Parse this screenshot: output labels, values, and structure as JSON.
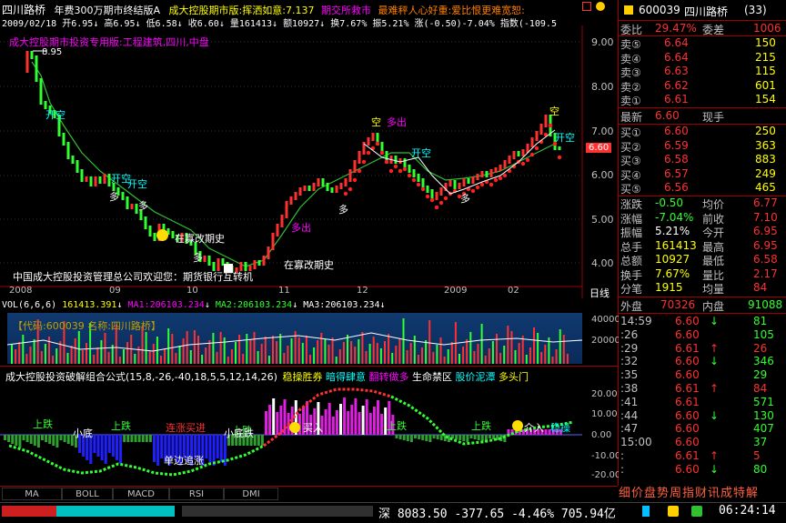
{
  "header": {
    "stock_name": "四川路桥",
    "promo1": "年费300万期市终结版A",
    "promo2": "成大控股期市版:挥洒如意:7.137",
    "promo3": "期交所救市",
    "promo4": "最难秤人心好重:爱比恨更难宽恕:",
    "ohlc_date": "2009/02/18",
    "ohlc_open": "开6.95",
    "ohlc_high": "高6.95",
    "ohlc_low": "低6.58",
    "ohlc_close": "收6.60",
    "ohlc_vol": "量161413",
    "ohlc_amt": "额10927",
    "ohlc_turn": "换7.67%",
    "ohlc_amp": "振5.21%",
    "ohlc_chg": "涨(-0.50)-7.04%",
    "ohlc_idx": "指数(-109.5",
    "subtitle": "成大控股期市投资专用版:工程建筑,四川,中盘"
  },
  "main_chart": {
    "price_ticks": [
      "9.00",
      "8.00",
      "7.00",
      "6.00",
      "5.00",
      "4.00"
    ],
    "current_price": "6.60",
    "max_label": "8.95",
    "date_labels": [
      "2008",
      "09",
      "10",
      "11",
      "12",
      "2009",
      "02"
    ],
    "period": "日线",
    "annotations": {
      "kaikong1": "开空",
      "kaikong2": "开空",
      "kaikong3": "开空",
      "kaikong4": "开空",
      "kaikong5": "开空",
      "duo1": "多",
      "duo2": "多",
      "duo3": "多",
      "duo4": "多",
      "duo5": "多",
      "duo_chu": "多出",
      "duo_chu2": "多出",
      "kong": "空",
      "kong2": "空",
      "zai_cuo_qi": "在寡改期史",
      "zai_cuo_qi2": "在寡改期史",
      "welcome": "中国成大控股投资管理总公司欢迎您：期货银行互转机"
    }
  },
  "volume_panel": {
    "title": "VOL(6,6,6)",
    "vol": "161413.391",
    "ma1": "MA1:206103.234",
    "ma2": "MA2:206103.234",
    "ma3": "MA3:206103.234",
    "code_label": "【代码:600039 名称:四川路桥】",
    "ticks": [
      "400000",
      "200000"
    ]
  },
  "indicator_panel": {
    "title": "成大控股投资破解组合公式(15,8,-26,-40,18,5,5,12,14,26)",
    "tag1": "稳操胜券",
    "tag2": "暗得肆意",
    "tag3": "翻转做多",
    "tag4": "生命禁区",
    "tag5": "股价泥潭",
    "tag6": "多头门",
    "ticks": [
      "20.00",
      "10.00",
      "0.00",
      "-10.00",
      "-20.00"
    ],
    "labels": {
      "shangdie1": "上跌",
      "xiaodi": "小底",
      "shangdie2": "上跌",
      "lianzhang": "连涨买进",
      "shangdie3": "上跌",
      "xiaodi2": "小底跌",
      "danbian": "单边追涨",
      "shangdie4": "上跌",
      "shangdie5": "上跌",
      "jinru": "买入",
      "jinru2": "介入",
      "wenyi": "稳操"
    }
  },
  "tabs": [
    "MA",
    "BOLL",
    "MACD",
    "RSI",
    "DMI"
  ],
  "right_panel": {
    "code": "600039",
    "name": "四川路桥",
    "num": "(33)",
    "weibi_label": "委比",
    "weibi_value": "29.47%",
    "weicha_label": "委差",
    "weicha_value": "1006",
    "asks": [
      {
        "label": "卖⑤",
        "price": "6.64",
        "vol": "150"
      },
      {
        "label": "卖④",
        "price": "6.64",
        "vol": "215"
      },
      {
        "label": "卖③",
        "price": "6.63",
        "vol": "115"
      },
      {
        "label": "卖②",
        "price": "6.62",
        "vol": "601"
      },
      {
        "label": "卖①",
        "price": "6.61",
        "vol": "154"
      }
    ],
    "latest_label": "最新",
    "latest_value": "6.60",
    "xianshou_label": "现手",
    "bids": [
      {
        "label": "买①",
        "price": "6.60",
        "vol": "250"
      },
      {
        "label": "买②",
        "price": "6.59",
        "vol": "363"
      },
      {
        "label": "买③",
        "price": "6.58",
        "vol": "883"
      },
      {
        "label": "买④",
        "price": "6.57",
        "vol": "249"
      },
      {
        "label": "买⑤",
        "price": "6.56",
        "vol": "465"
      }
    ],
    "stats": [
      {
        "l1": "涨跌",
        "v1": "-0.50",
        "l2": "均价",
        "v2": "6.77"
      },
      {
        "l1": "涨幅",
        "v1": "-7.04%",
        "l2": "前收",
        "v2": "7.10"
      },
      {
        "l1": "振幅",
        "v1": "5.21%",
        "l2": "今开",
        "v2": "6.95"
      },
      {
        "l1": "总手",
        "v1": "161413",
        "l2": "最高",
        "v2": "6.95"
      },
      {
        "l1": "总额",
        "v1": "10927",
        "l2": "最低",
        "v2": "6.58"
      },
      {
        "l1": "换手",
        "v1": "7.67%",
        "l2": "量比",
        "v2": "2.17"
      },
      {
        "l1": "分笔",
        "v1": "1915",
        "l2": "均量",
        "v2": "84"
      }
    ],
    "waipan_label": "外盘",
    "waipan_value": "70326",
    "neipan_label": "内盘",
    "neipan_value": "91088",
    "ticks": [
      {
        "time": "14:59",
        "price": "6.60",
        "dir": "↓",
        "vol": "81"
      },
      {
        "time": ":26",
        "price": "6.60",
        "dir": "",
        "vol": "105"
      },
      {
        "time": ":29",
        "price": "6.61",
        "dir": "↑",
        "vol": "26"
      },
      {
        "time": ":32",
        "price": "6.60",
        "dir": "↓",
        "vol": "346"
      },
      {
        "time": ":35",
        "price": "6.60",
        "dir": "",
        "vol": "29"
      },
      {
        "time": ":38",
        "price": "6.61",
        "dir": "↑",
        "vol": "84"
      },
      {
        "time": ":41",
        "price": "6.61",
        "dir": "",
        "vol": "571"
      },
      {
        "time": ":44",
        "price": "6.60",
        "dir": "↓",
        "vol": "130"
      },
      {
        "time": ":47",
        "price": "6.60",
        "dir": "",
        "vol": "407"
      },
      {
        "time": "15:00",
        "price": "6.60",
        "dir": "",
        "vol": "37"
      },
      {
        "time": ":",
        "price": "6.61",
        "dir": "↑",
        "vol": "5"
      },
      {
        "time": ":",
        "price": "6.60",
        "dir": "↓",
        "vol": "80"
      }
    ],
    "bottom_tabs": "细价盘势周指财讯成特解"
  },
  "statusbar": {
    "index_label": "深",
    "index_value": "8083.50",
    "change": "-377.65",
    "pct": "-4.46%",
    "amount": "705.94亿",
    "time": "06:24:14"
  },
  "colors": {
    "up": "#ff3030",
    "down": "#30ff30",
    "border": "#a00000",
    "volume_bg": "#0a2a5a"
  }
}
